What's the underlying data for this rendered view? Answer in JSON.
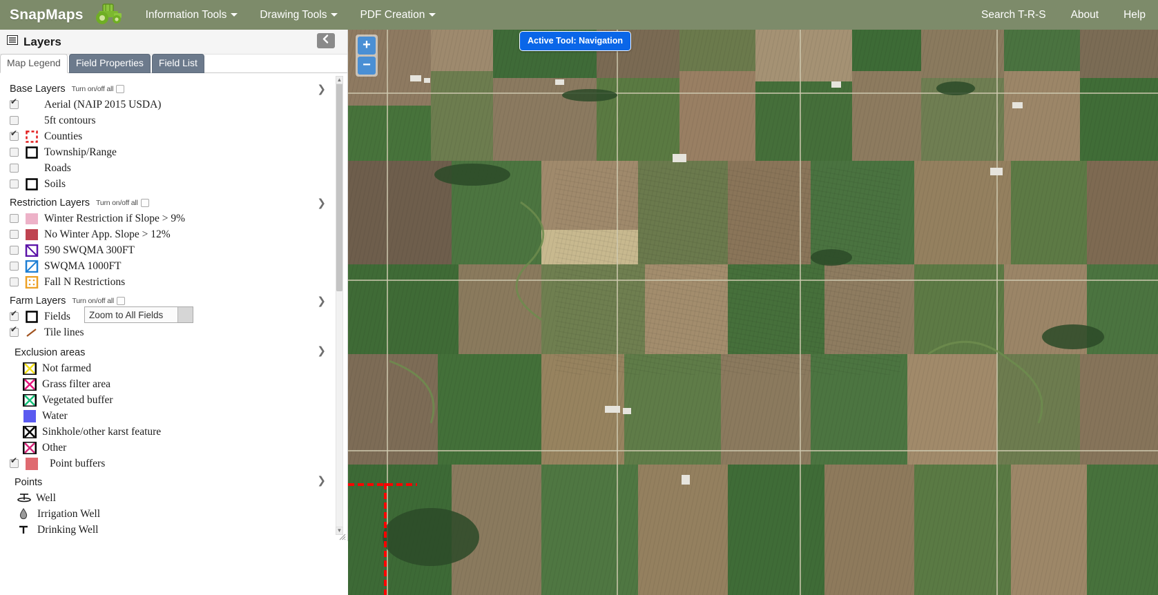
{
  "navbar": {
    "brand": "SnapMaps",
    "logo_icon": "tractor-icon",
    "menus": [
      {
        "label": "Information Tools",
        "has_caret": true
      },
      {
        "label": "Drawing Tools",
        "has_caret": true
      },
      {
        "label": "PDF Creation",
        "has_caret": true
      }
    ],
    "right_links": [
      {
        "label": "Search T-R-S"
      },
      {
        "label": "About"
      },
      {
        "label": "Help"
      }
    ],
    "background_color": "#7d8b6a"
  },
  "sidebar": {
    "panel_title": "Layers",
    "panel_icon": "list-icon",
    "collapse_icon": "chevron-left-icon",
    "tabs": [
      {
        "label": "Map Legend",
        "active": true
      },
      {
        "label": "Field Properties",
        "active": false
      },
      {
        "label": "Field List",
        "active": false
      }
    ],
    "turn_all_label": "Turn on/off all",
    "groups": [
      {
        "name": "Base Layers",
        "layers": [
          {
            "label": "Aerial (NAIP 2015 USDA)",
            "checked": true,
            "swatch": "blank"
          },
          {
            "label": "5ft contours",
            "checked": false,
            "swatch": "blank"
          },
          {
            "label": "Counties",
            "checked": true,
            "swatch": "red-dashed"
          },
          {
            "label": "Township/Range",
            "checked": false,
            "swatch": "black-outline"
          },
          {
            "label": "Roads",
            "checked": false,
            "swatch": "blank"
          },
          {
            "label": "Soils",
            "checked": false,
            "swatch": "black-outline"
          }
        ]
      },
      {
        "name": "Restriction Layers",
        "layers": [
          {
            "label": "Winter Restriction if Slope > 9%",
            "checked": false,
            "swatch": "pink-fill"
          },
          {
            "label": "No Winter App. Slope > 12%",
            "checked": false,
            "swatch": "darkred-fill"
          },
          {
            "label": "590 SWQMA 300FT",
            "checked": false,
            "swatch": "purple-hatch"
          },
          {
            "label": "SWQMA 1000FT",
            "checked": false,
            "swatch": "blue-hatch"
          },
          {
            "label": "Fall N Restrictions",
            "checked": false,
            "swatch": "orange-dotted"
          }
        ]
      },
      {
        "name": "Farm Layers",
        "layers": [
          {
            "label": "Fields",
            "checked": true,
            "swatch": "black-outline"
          },
          {
            "label": "Tile lines",
            "checked": true,
            "swatch": "brown-line"
          }
        ]
      }
    ],
    "zoom_fields_select": {
      "value": "Zoom to All Fields"
    },
    "exclusion": {
      "name": "Exclusion areas",
      "checked": true,
      "items": [
        {
          "label": "Not farmed",
          "swatch": "yellow-x"
        },
        {
          "label": "Grass filter area",
          "swatch": "magenta-x"
        },
        {
          "label": "Vegetated buffer",
          "swatch": "green-x"
        },
        {
          "label": "Water",
          "swatch": "blue-fill"
        },
        {
          "label": "Sinkhole/other karst feature",
          "swatch": "black-x"
        },
        {
          "label": "Other",
          "swatch": "pink-x"
        },
        {
          "label": "Point buffers",
          "swatch": "red-fill",
          "checked": true
        }
      ]
    },
    "points": {
      "name": "Points",
      "checked": true,
      "items": [
        {
          "label": "Well",
          "icon": "well-icon"
        },
        {
          "label": "Irrigation Well",
          "icon": "irrigation-well-icon"
        },
        {
          "label": "Drinking Well",
          "icon": "drinking-well-icon"
        }
      ]
    }
  },
  "map": {
    "zoom_in_label": "+",
    "zoom_out_label": "−",
    "active_tool_badge": "Active Tool: Navigation",
    "badge_color": "#0a66e8",
    "county_boundary_color": "#fb0200"
  }
}
